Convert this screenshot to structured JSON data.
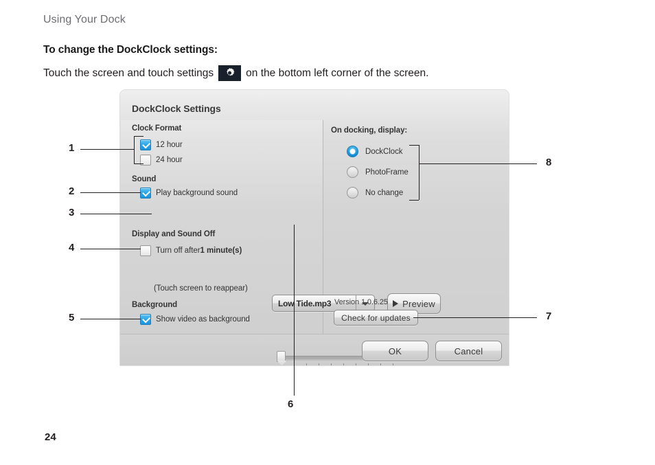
{
  "page": {
    "running_head": "Using Your Dock",
    "heading": "To change the DockClock settings:",
    "body_before": "Touch the screen and touch settings",
    "body_after": "on the bottom left corner of the screen.",
    "gear_icon": "gear-icon",
    "page_number": "24"
  },
  "dialog": {
    "title": "DockClock Settings",
    "left": {
      "clock_format": {
        "label": "Clock Format",
        "options": [
          {
            "label": "12 hour",
            "checked": true
          },
          {
            "label": "24 hour",
            "checked": false
          }
        ]
      },
      "sound": {
        "label": "Sound",
        "play_background_sound": {
          "label": "Play background sound",
          "checked": true
        },
        "track_select": {
          "value": "Low Tide.mp3",
          "arrow_icon": "chevron-down-icon"
        },
        "preview_button": {
          "label": "Preview",
          "icon": "play-triangle-icon"
        }
      },
      "display_sound_off": {
        "label": "Display and Sound Off",
        "turn_off_after": {
          "prefix": "Turn off after",
          "value": "1 minute(s)",
          "checked": false
        },
        "slider": {
          "position_percent": 0,
          "ticks": 9
        },
        "hint": "(Touch screen to reappear)"
      },
      "background": {
        "label": "Background",
        "show_video": {
          "label": "Show video as background",
          "checked": true
        }
      }
    },
    "right": {
      "on_docking_label": "On docking, display:",
      "options": [
        {
          "label": "DockClock",
          "selected": true
        },
        {
          "label": "PhotoFrame",
          "selected": false
        },
        {
          "label": "No change",
          "selected": false
        }
      ],
      "version": "Version 1.0.6.25",
      "check_updates_label": "Check for updates"
    },
    "footer": {
      "ok_label": "OK",
      "cancel_label": "Cancel"
    }
  },
  "callouts": [
    {
      "id": "1",
      "number": "1"
    },
    {
      "id": "2",
      "number": "2"
    },
    {
      "id": "3",
      "number": "3"
    },
    {
      "id": "4",
      "number": "4"
    },
    {
      "id": "5",
      "number": "5"
    },
    {
      "id": "6",
      "number": "6"
    },
    {
      "id": "7",
      "number": "7"
    },
    {
      "id": "8",
      "number": "8"
    }
  ],
  "colors": {
    "accent": "#1e9ce4",
    "dialog_bg": "#d6d6d6",
    "running_head": "#6d6e71",
    "gear_chip_bg": "#17202b"
  }
}
